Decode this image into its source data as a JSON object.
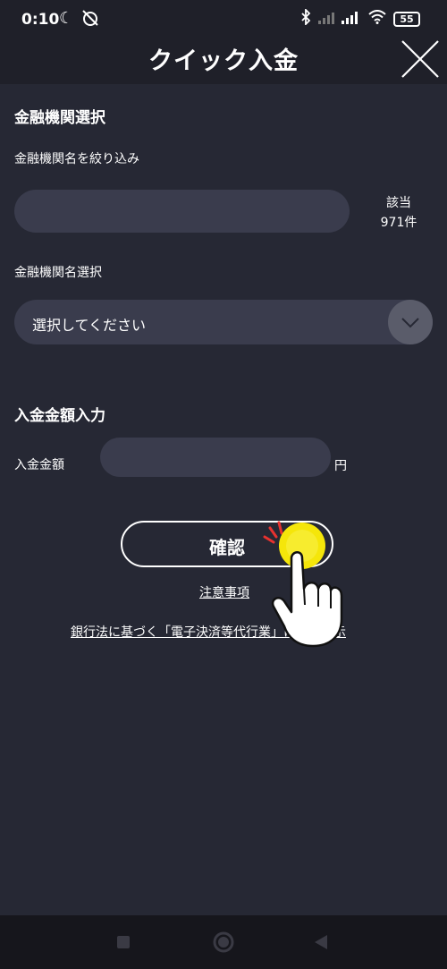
{
  "status_bar": {
    "time": "0:10",
    "battery": "55"
  },
  "header": {
    "title": "クイック入金"
  },
  "bank_section": {
    "title": "金融機関選択",
    "filter_label": "金融機関名を絞り込み",
    "filter_value": "",
    "match_label": "該当",
    "match_count": "971件",
    "select_label": "金融機関名選択",
    "select_value": "選択してください"
  },
  "amount_section": {
    "title": "入金金額入力",
    "amount_label": "入金金額",
    "amount_value": "",
    "unit": "円"
  },
  "actions": {
    "confirm_label": "確認",
    "notes_link": "注意事項",
    "disclosure_link": "銀行法に基づく「電子決済等代行業」に係る表示"
  },
  "colors": {
    "background": "#262834",
    "header": "#1f2029",
    "field": "#3a3c4d",
    "tap_highlight": "#f5e60a"
  },
  "icons": [
    "moon-icon",
    "alarm-off-icon",
    "bluetooth-icon",
    "signal-icon",
    "wifi-icon",
    "battery-icon",
    "close-icon",
    "chevron-down-icon",
    "tap-hand-icon",
    "nav-square-icon",
    "nav-circle-icon",
    "nav-back-icon"
  ]
}
